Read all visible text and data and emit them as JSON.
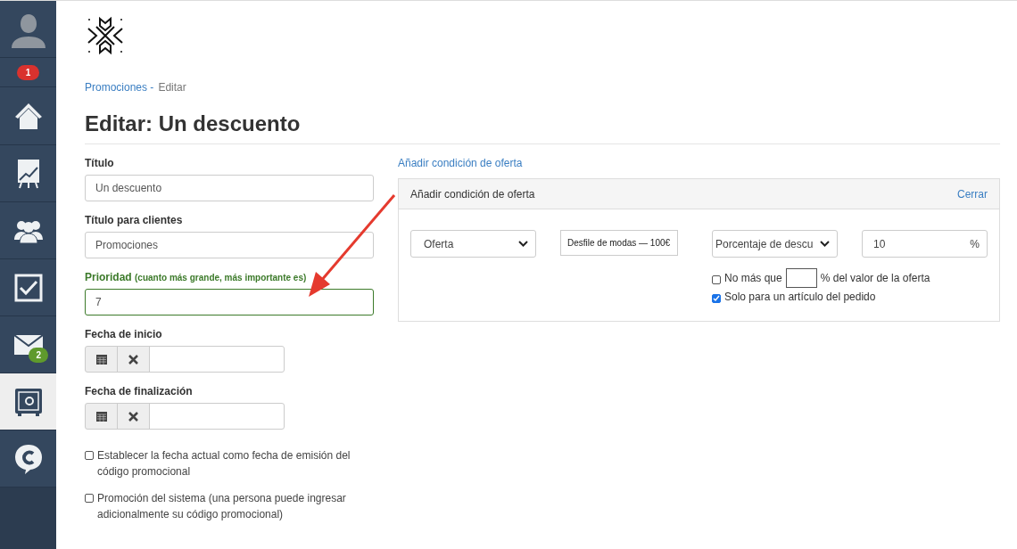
{
  "sidebar": {
    "items": [
      {
        "kind": "avatar",
        "selected": false
      },
      {
        "kind": "badge",
        "badge": "1",
        "color": "#d9322e"
      },
      {
        "kind": "home",
        "selected": false
      },
      {
        "kind": "chart",
        "selected": false
      },
      {
        "kind": "people",
        "selected": false
      },
      {
        "kind": "tasks",
        "selected": false
      },
      {
        "kind": "mail",
        "selected": false,
        "badge": "2",
        "color": "#5f9a2c"
      },
      {
        "kind": "safe",
        "selected": true
      },
      {
        "kind": "chat",
        "selected": false
      }
    ]
  },
  "breadcrumb": {
    "link": "Promociones -",
    "current": "Editar"
  },
  "title": "Editar: Un descuento",
  "form": {
    "fields": [
      {
        "kind": "text",
        "label": "Título",
        "value": "Un descuento",
        "highlighted": false
      },
      {
        "kind": "text",
        "label": "Título para clientes",
        "value": "Promociones",
        "highlighted": false
      },
      {
        "kind": "text",
        "label": "Prioridad",
        "hint": "(cuanto más grande, más importante es)",
        "value": "7",
        "highlighted": true
      },
      {
        "kind": "date",
        "label": "Fecha de inicio",
        "highlighted": false
      },
      {
        "kind": "date",
        "label": "Fecha de finalización",
        "highlighted": false
      }
    ],
    "checkboxes": [
      {
        "label": "Establecer la fecha actual como fecha de emisión del código promocional",
        "checked": false
      },
      {
        "label": "Promoción del sistema (una persona puede ingresar adicionalmente su código promocional)",
        "checked": false
      }
    ]
  },
  "offer": {
    "add_link": "Añadir condición de oferta",
    "panel_title": "Añadir condición de oferta",
    "close": "Cerrar",
    "type_select": "Oferta",
    "product": "Desfile de modas — 100€",
    "discount_select": "Porcentaje de descu",
    "amount": "10",
    "unit": "%",
    "options": [
      {
        "kind": "limit",
        "before": "No más que",
        "after": "% del valor de la oferta",
        "checked": false
      },
      {
        "kind": "plain",
        "label": "Solo para un artículo del pedido",
        "checked": true
      }
    ]
  }
}
